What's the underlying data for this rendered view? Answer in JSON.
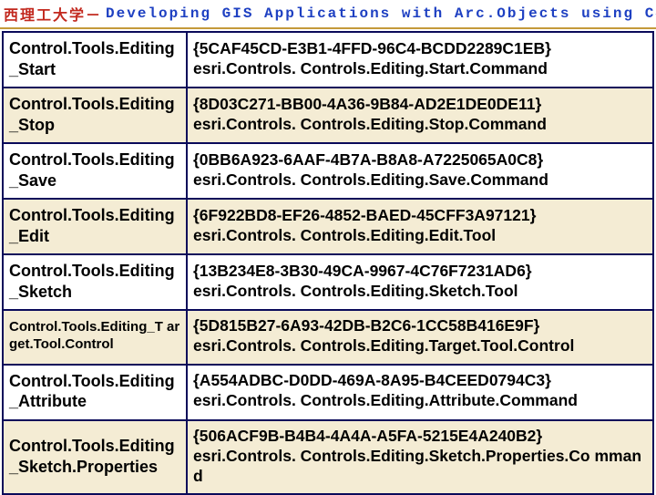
{
  "header": {
    "cn": "西理工大学",
    "sep": "－",
    "en": "Developing GIS Applications with Arc.Objects using C#. NE"
  },
  "rows": [
    {
      "name": "Control.Tools.Editing _Start",
      "guid": "{5CAF45CD-E3B1-4FFD-96C4-BCDD2289C1EB}",
      "cls": "esri.Controls. Controls.Editing.Start.Command",
      "alt": false,
      "small": false
    },
    {
      "name": "Control.Tools.Editing _Stop",
      "guid": "{8D03C271-BB00-4A36-9B84-AD2E1DE0DE11}",
      "cls": "esri.Controls. Controls.Editing.Stop.Command",
      "alt": true,
      "small": false
    },
    {
      "name": "Control.Tools.Editing _Save",
      "guid": "{0BB6A923-6AAF-4B7A-B8A8-A7225065A0C8}",
      "cls": "esri.Controls. Controls.Editing.Save.Command",
      "alt": false,
      "small": false
    },
    {
      "name": "Control.Tools.Editing _Edit",
      "guid": "{6F922BD8-EF26-4852-BAED-45CFF3A97121}",
      "cls": "esri.Controls. Controls.Editing.Edit.Tool",
      "alt": true,
      "small": false
    },
    {
      "name": "Control.Tools.Editing _Sketch",
      "guid": "{13B234E8-3B30-49CA-9967-4C76F7231AD6}",
      "cls": "esri.Controls. Controls.Editing.Sketch.Tool",
      "alt": false,
      "small": false
    },
    {
      "name": "Control.Tools.Editing_T arget.Tool.Control",
      "guid": "{5D815B27-6A93-42DB-B2C6-1CC58B416E9F}",
      "cls": "esri.Controls. Controls.Editing.Target.Tool.Control",
      "alt": true,
      "small": true
    },
    {
      "name": "Control.Tools.Editing _Attribute",
      "guid": "{A554ADBC-D0DD-469A-8A95-B4CEED0794C3}",
      "cls": "esri.Controls. Controls.Editing.Attribute.Command",
      "alt": false,
      "small": false
    },
    {
      "name": "Control.Tools.Editing _Sketch.Properties",
      "guid": "{506ACF9B-B4B4-4A4A-A5FA-5215E4A240B2}",
      "cls": "esri.Controls. Controls.Editing.Sketch.Properties.Co mmand",
      "alt": true,
      "small": false
    }
  ]
}
